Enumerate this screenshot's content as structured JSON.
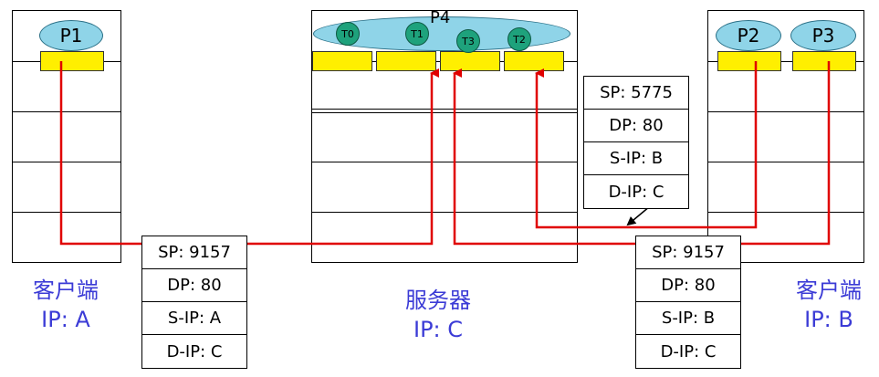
{
  "left_host": {
    "process": "P1",
    "role": "客户端",
    "ip": "IP: A"
  },
  "server": {
    "process": "P4",
    "threads": [
      "T0",
      "T1",
      "T3",
      "T2"
    ],
    "role": "服务器",
    "ip": "IP: C"
  },
  "right_host": {
    "processes": [
      "P2",
      "P3"
    ],
    "role": "客户端",
    "ip": "IP: B"
  },
  "packet_a": {
    "sp": "SP: 9157",
    "dp": "DP: 80",
    "sip": "S-IP: A",
    "dip": "D-IP: C"
  },
  "packet_b1": {
    "sp": "SP: 5775",
    "dp": "DP: 80",
    "sip": "S-IP: B",
    "dip": "D-IP: C"
  },
  "packet_b2": {
    "sp": "SP: 9157",
    "dp": "DP: 80",
    "sip": "S-IP: B",
    "dip": "D-IP: C"
  },
  "colors": {
    "connection": "#e00000",
    "socket": "#ffef00",
    "process": "#8fd4e8",
    "thread": "#1ea27c",
    "label": "#3b3bd6"
  }
}
